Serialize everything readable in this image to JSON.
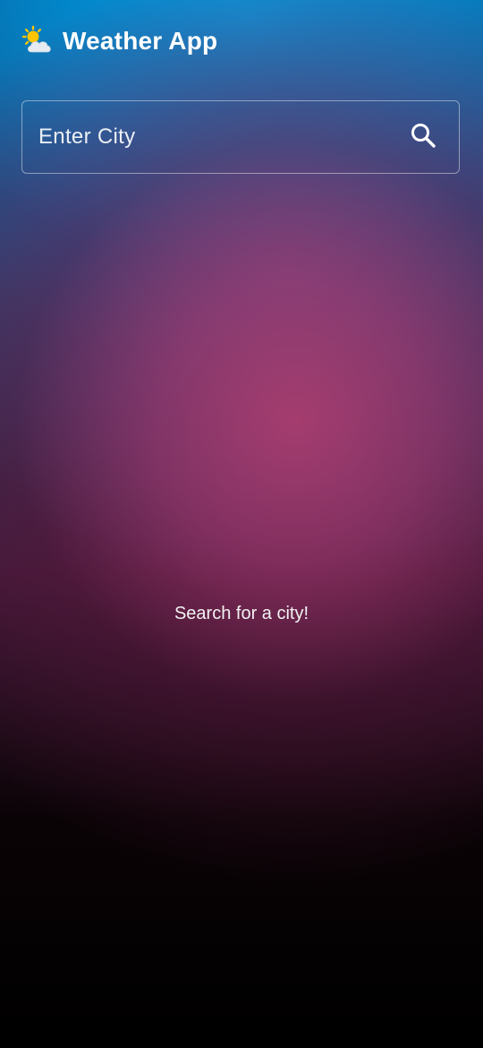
{
  "app_bar": {
    "icon": "sun-behind-cloud-icon",
    "title": "Weather App"
  },
  "search": {
    "placeholder": "Enter City",
    "value": "",
    "button_icon": "search-icon"
  },
  "main": {
    "status_text": "Search for a city!"
  },
  "colors": {
    "top_blue": "#0a9be0",
    "mid_purple": "#6a64a8",
    "mid_magenta": "#a03a6c",
    "bottom": "#000000",
    "text": "#ffffff"
  }
}
